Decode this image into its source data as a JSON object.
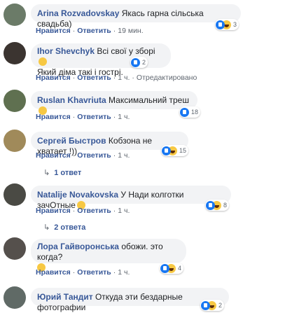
{
  "comments": [
    {
      "name": "Arina Rozvadovskay",
      "text": "Якась гарна сільська свадьба)",
      "actions": [
        "Нравится",
        "Ответить",
        "19 мин."
      ],
      "reactions": "3",
      "avatar_color": "#6b7b68"
    },
    {
      "name": "Ihor Shevchyk",
      "text": "Всі свої у зборі",
      "text2": "Який діма такі і гострі.",
      "actions": [
        "Нравится",
        "Ответить",
        "1 ч.",
        "Отредактировано"
      ],
      "reactions": "2",
      "avatar_color": "#3b3430"
    },
    {
      "name": "Ruslan Khavriuta",
      "text": "Максимальний треш",
      "actions": [
        "Нравится",
        "Ответить",
        "1 ч."
      ],
      "reactions": "18",
      "avatar_color": "#5f7050"
    },
    {
      "name": "Сергей Быстров",
      "text": "Кобзона не хватает !))",
      "actions": [
        "Нравится",
        "Ответить",
        "1 ч."
      ],
      "reactions": "15",
      "avatar_color": "#a08a5a",
      "replies": "1 ответ"
    },
    {
      "name": "Natalije Novakovska",
      "text": "У Нади колготки зачОтные",
      "actions": [
        "Нравится",
        "Ответить",
        "1 ч."
      ],
      "reactions": "8",
      "avatar_color": "#4a4a44",
      "replies": "2 ответа"
    },
    {
      "name": "Лора Гайворонська",
      "text": "обожи. это когда?",
      "actions": [
        "Нравится",
        "Ответить",
        "1 ч."
      ],
      "reactions": "4",
      "avatar_color": "#55504c"
    },
    {
      "name": "Юрий Тандит",
      "text": "Откуда эти бездарные фотографии",
      "reactions": "2",
      "avatar_color": "#606a66"
    }
  ]
}
